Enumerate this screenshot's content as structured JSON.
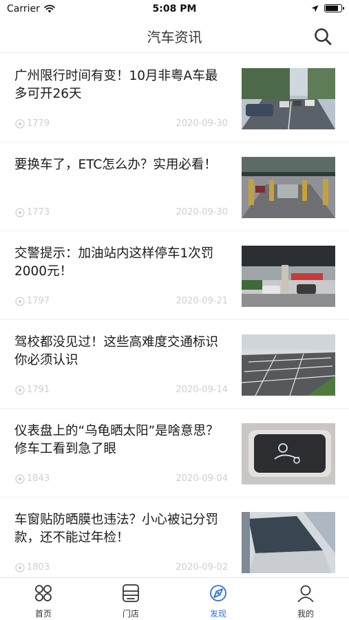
{
  "status_bar": {
    "carrier": "Carrier",
    "time": "5:08 PM",
    "battery_level": 0.85
  },
  "header": {
    "title": "汽车资讯",
    "search_icon": "search-icon"
  },
  "articles": [
    {
      "title": "广州限行时间有变！10月非粤A车最多可开26天",
      "views": "1779",
      "date": "2020-09-30"
    },
    {
      "title": "要换车了，ETC怎么办？实用必看！",
      "views": "1773",
      "date": "2020-09-30"
    },
    {
      "title": "交警提示：加油站内这样停车1次罚2000元！",
      "views": "1797",
      "date": "2020-09-21"
    },
    {
      "title": "驾校都没见过！这些高难度交通标识你必须认识",
      "views": "1791",
      "date": "2020-09-14"
    },
    {
      "title": "仪表盘上的“乌龟晒太阳”是啥意思？修车工看到急了眼",
      "views": "1843",
      "date": "2020-09-04"
    },
    {
      "title": "车窗贴防晒膜也违法？小心被记分罚款，还不能过年检！",
      "views": "1803",
      "date": "2020-09-02"
    }
  ],
  "tabbar": {
    "items": [
      {
        "label": "首页",
        "icon": "home-grid-icon"
      },
      {
        "label": "门店",
        "icon": "store-icon"
      },
      {
        "label": "发现",
        "icon": "discover-icon"
      },
      {
        "label": "我的",
        "icon": "profile-icon"
      }
    ],
    "active_index": 2,
    "active_color": "#2b6de0"
  }
}
